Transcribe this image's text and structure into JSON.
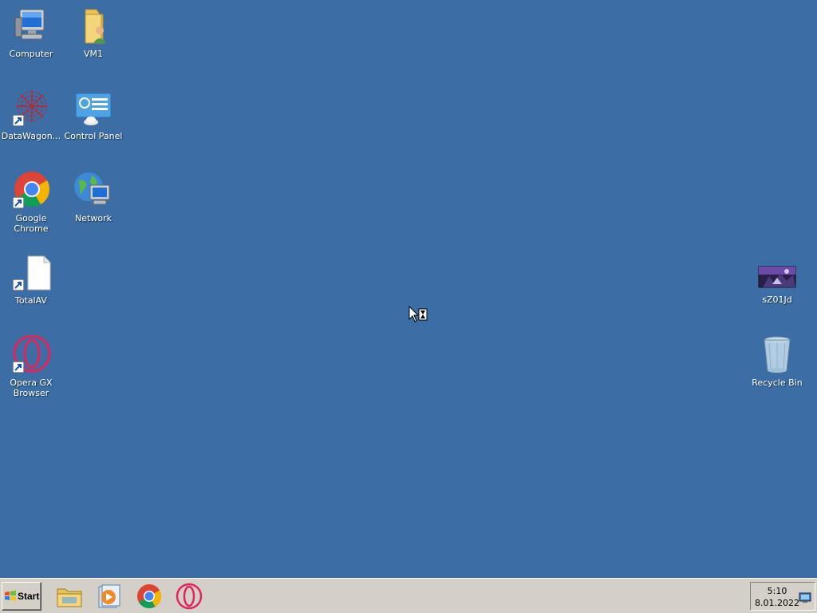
{
  "desktop_icons": {
    "computer": {
      "label": "Computer",
      "icon": "computer-icon"
    },
    "vm1": {
      "label": "VM1",
      "icon": "user-folder-icon"
    },
    "datawagon": {
      "label": "DataWagon...",
      "icon": "datawagon-icon"
    },
    "control_panel": {
      "label": "Control Panel",
      "icon": "control-panel-icon"
    },
    "chrome": {
      "label": "Google Chrome",
      "icon": "chrome-icon"
    },
    "network": {
      "label": "Network",
      "icon": "network-icon"
    },
    "totalav": {
      "label": "TotalAV",
      "icon": "blank-file-icon"
    },
    "opera": {
      "label_line1": "Opera GX",
      "label_line2": "Browser",
      "icon": "opera-gx-icon"
    },
    "sz01jd": {
      "label": "sZ01Jd",
      "icon": "image-thumbnail-icon"
    },
    "recycle_bin": {
      "label": "Recycle Bin",
      "icon": "recycle-bin-icon"
    }
  },
  "taskbar": {
    "start_label": "Start",
    "quick_launch": [
      "explorer-icon",
      "media-player-icon",
      "chrome-icon",
      "opera-icon"
    ],
    "clock_time": "5:10",
    "clock_date": "8.01.2022",
    "tray_icon": "network-monitor-icon"
  },
  "colors": {
    "desktop": "#3c6ea5",
    "taskbar": "#d4d0c8"
  }
}
